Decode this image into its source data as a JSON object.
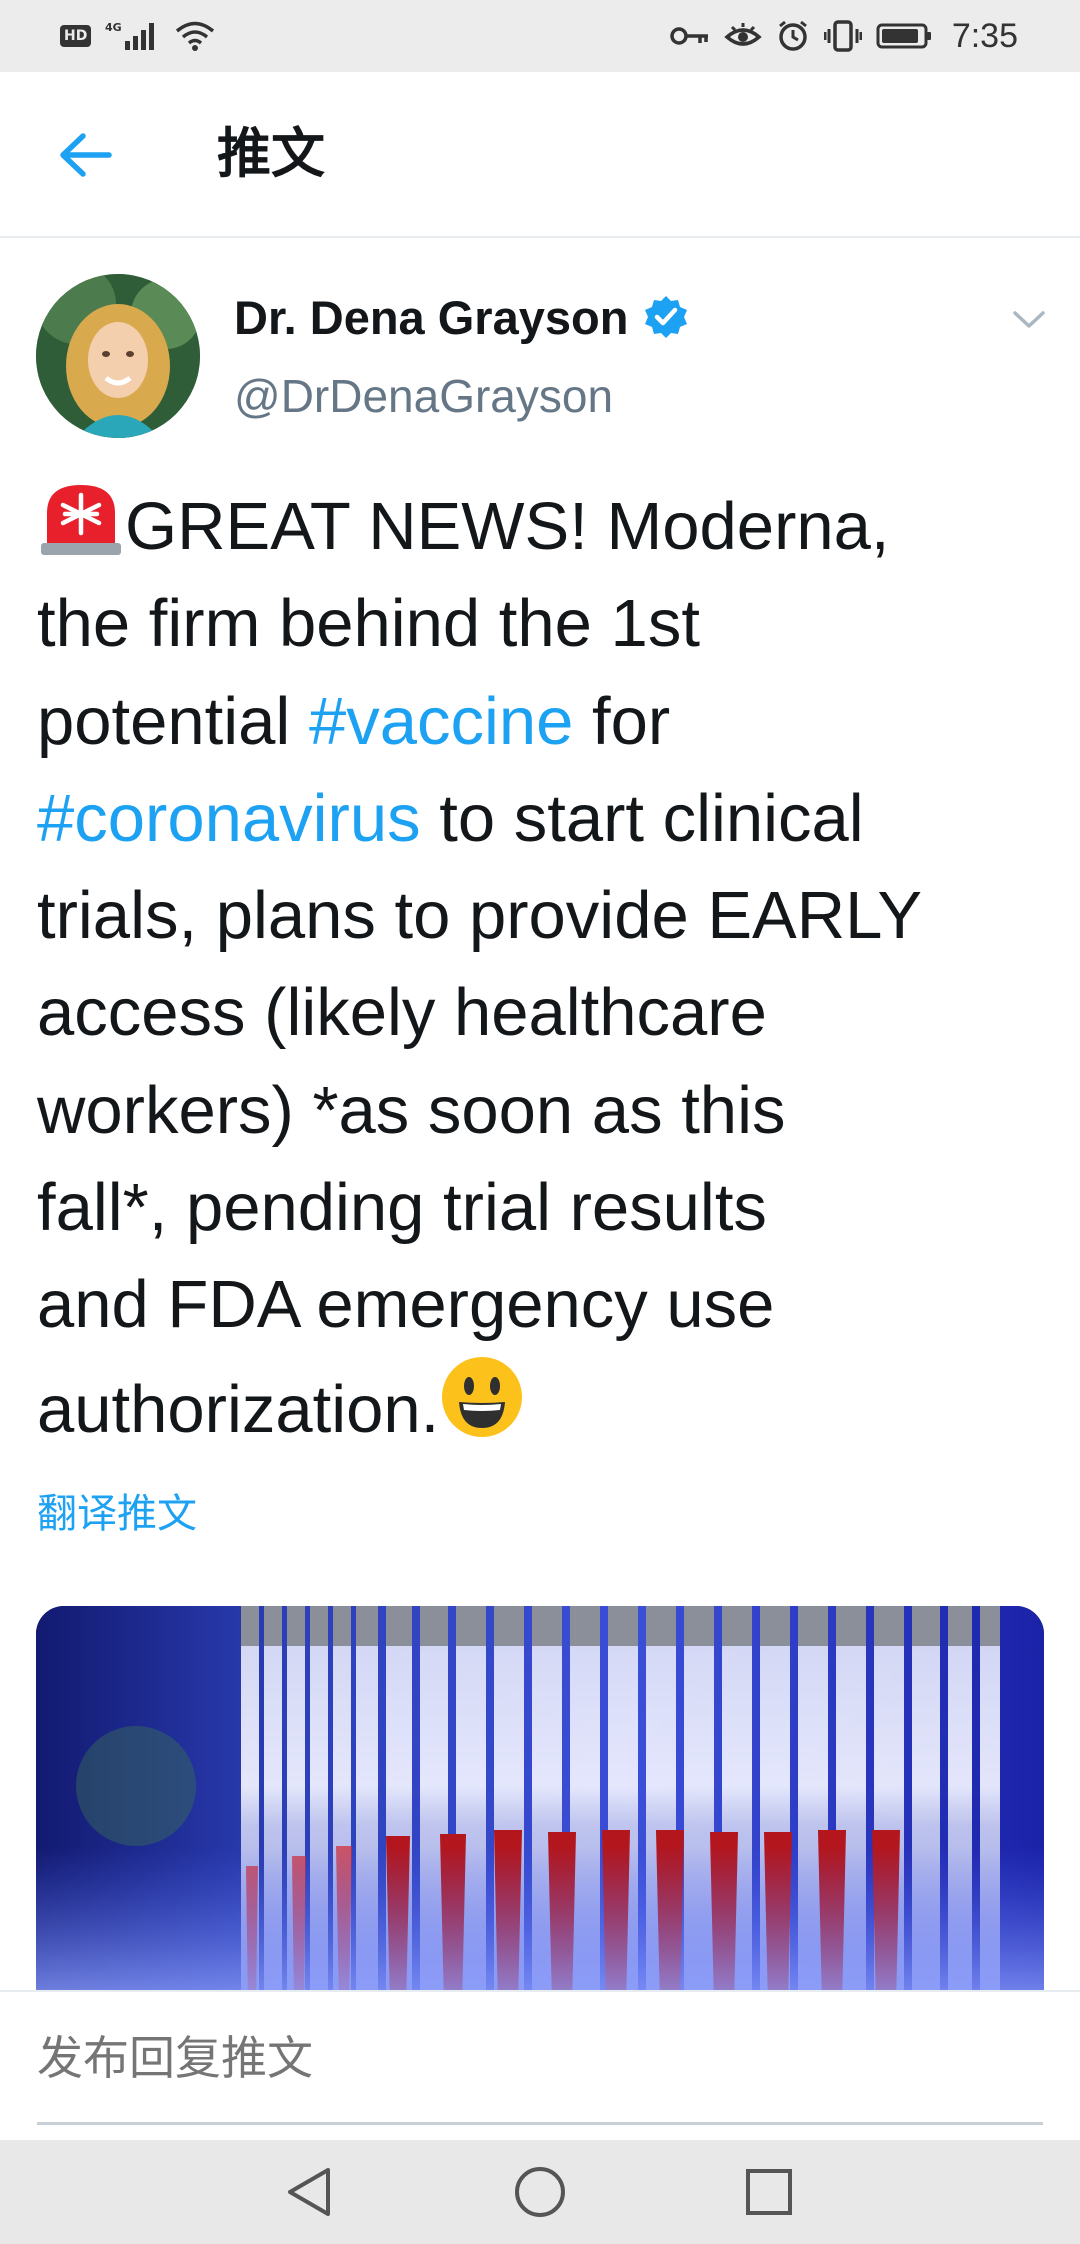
{
  "status_bar": {
    "hd_label": "HD",
    "network_label": "4G",
    "time": "7:35"
  },
  "header": {
    "title": "推文",
    "back_icon": "arrow-left-icon"
  },
  "tweet": {
    "author_name": "Dr. Dena Grayson",
    "author_handle": "@DrDenaGrayson",
    "verified": true,
    "lines": [
      {
        "pre_emoji": "rotating-light",
        "text": "GREAT NEWS! Moderna,"
      },
      {
        "text": "the firm behind the 1st"
      },
      {
        "pre": "potential ",
        "hashtag": "#vaccine",
        "post": " for"
      },
      {
        "hashtag": "#coronavirus",
        "post": " to start clinical"
      },
      {
        "text": "trials, plans to provide EARLY"
      },
      {
        "text": "access (likely healthcare"
      },
      {
        "text": "workers) *as soon as this"
      },
      {
        "text": "fall*, pending trial results"
      },
      {
        "text": "and FDA emergency use"
      },
      {
        "text": "authorization.",
        "post_emoji": "smiley"
      }
    ],
    "translate_label": "翻译推文"
  },
  "reply": {
    "placeholder": "发布回复推文"
  },
  "colors": {
    "accent": "#1da1f2",
    "text": "#14171a",
    "muted": "#657786",
    "status_bar_bg": "#ececec",
    "nav_bar_bg": "#e8e8e8"
  }
}
